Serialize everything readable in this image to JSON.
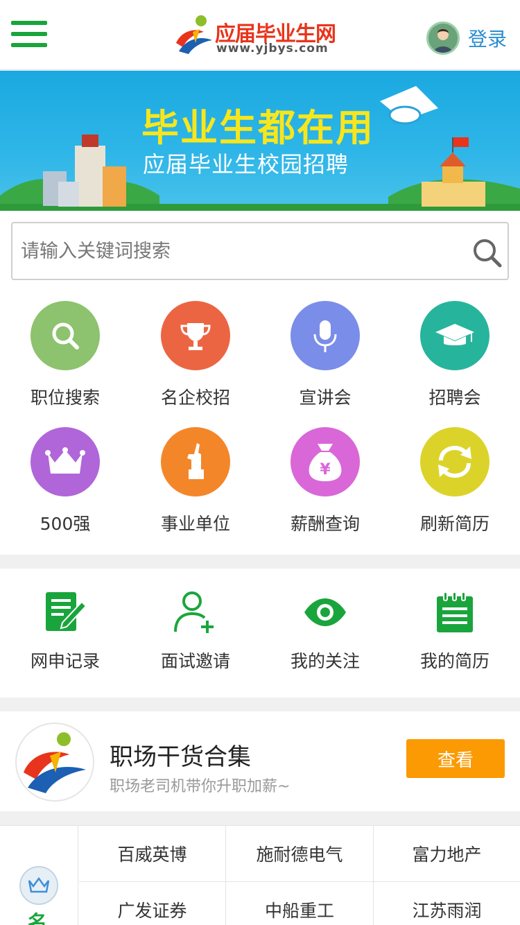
{
  "header": {
    "logo_title": "应届毕业生网",
    "logo_url": "www.yjbys.com",
    "login_label": "登录"
  },
  "banner": {
    "title": "毕业生都在用",
    "subtitle": "应届毕业生校园招聘"
  },
  "search": {
    "placeholder": "请输入关键词搜索",
    "value": ""
  },
  "grid": [
    {
      "label": "职位搜索",
      "icon": "search-icon",
      "color": "#8dc26f"
    },
    {
      "label": "名企校招",
      "icon": "trophy-icon",
      "color": "#ec6543"
    },
    {
      "label": "宣讲会",
      "icon": "microphone-icon",
      "color": "#7a8de8"
    },
    {
      "label": "招聘会",
      "icon": "graduation-cap-icon",
      "color": "#27b49c"
    },
    {
      "label": "500强",
      "icon": "crown-icon",
      "color": "#b066d8"
    },
    {
      "label": "事业单位",
      "icon": "statue-icon",
      "color": "#f4862a"
    },
    {
      "label": "薪酬查询",
      "icon": "money-bag-icon",
      "color": "#d967d8"
    },
    {
      "label": "刷新简历",
      "icon": "refresh-icon",
      "color": "#dcd32a"
    }
  ],
  "quick": [
    {
      "label": "网申记录",
      "icon": "edit-document-icon"
    },
    {
      "label": "面试邀请",
      "icon": "add-user-icon"
    },
    {
      "label": "我的关注",
      "icon": "eye-icon"
    },
    {
      "label": "我的简历",
      "icon": "resume-icon"
    }
  ],
  "promo": {
    "title": "职场干货合集",
    "subtitle": "职场老司机带你升职加薪~",
    "button_label": "查看"
  },
  "companies": {
    "side_label": "名",
    "items": [
      "百威英博",
      "施耐德电气",
      "富力地产",
      "广发证券",
      "中船重工",
      "江苏雨润"
    ]
  },
  "colors": {
    "brand_green": "#1aa53c",
    "login_blue": "#2a8dd0",
    "button_orange": "#fb9a02",
    "banner_yellow": "#f8e61c",
    "quick_icon_green": "#1aa53c"
  }
}
